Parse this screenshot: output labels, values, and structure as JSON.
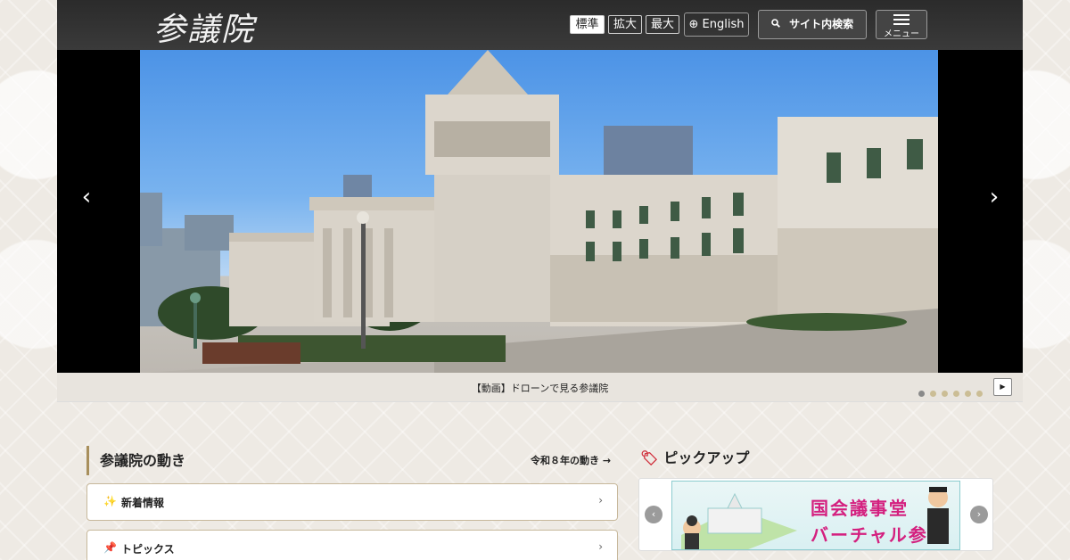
{
  "header": {
    "logo": "参議院",
    "font_sizes": [
      "標準",
      "拡大",
      "最大"
    ],
    "lang_label": "English",
    "search_label": "サイト内検索",
    "menu_label": "メニュー"
  },
  "hero": {
    "prev": "‹",
    "next": "›",
    "caption": "【動画】ドローンで見る参議院",
    "slide_count": 6,
    "active_slide": 1,
    "play": "▶"
  },
  "activity": {
    "title": "参議院の動き",
    "more": "令和８年の動き →",
    "items": [
      {
        "icon": "✨",
        "label": "新着情報",
        "chev": "›"
      },
      {
        "icon": "📌",
        "label": "トピックス",
        "chev": "›"
      }
    ]
  },
  "pickup": {
    "title": "ピックアップ",
    "banner_line1": "国会議事堂",
    "banner_line2": "バーチャル参観",
    "prev": "‹",
    "next": "›"
  },
  "colors": {
    "accent_gold": "#a88f5c",
    "pickup_tag": "#d0313d",
    "banner_text": "#d4207f"
  }
}
